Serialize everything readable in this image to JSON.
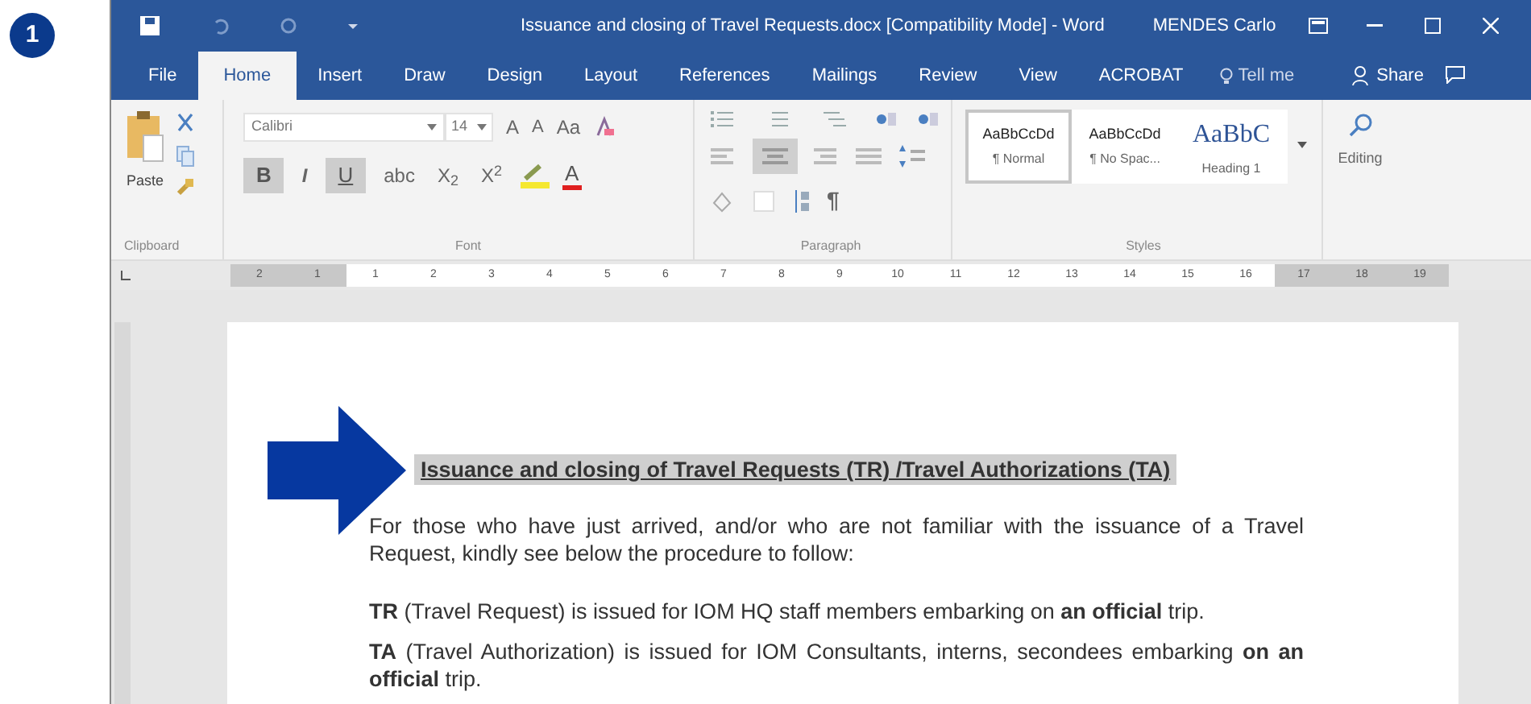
{
  "step_badge": "1",
  "window": {
    "title": "Issuance and closing of Travel Requests.docx [Compatibility Mode]  -  Word",
    "user": "MENDES Carlo"
  },
  "tabs": [
    {
      "label": "File",
      "selected": false
    },
    {
      "label": "Home",
      "selected": true
    },
    {
      "label": "Insert",
      "selected": false
    },
    {
      "label": "Draw",
      "selected": false
    },
    {
      "label": "Design",
      "selected": false
    },
    {
      "label": "Layout",
      "selected": false
    },
    {
      "label": "References",
      "selected": false
    },
    {
      "label": "Mailings",
      "selected": false
    },
    {
      "label": "Review",
      "selected": false
    },
    {
      "label": "View",
      "selected": false
    },
    {
      "label": "ACROBAT",
      "selected": false
    }
  ],
  "tell_me": "Tell me",
  "share": "Share",
  "clipboard": {
    "paste": "Paste",
    "label": "Clipboard"
  },
  "font": {
    "name": "Calibri",
    "size": "14",
    "grow": "A",
    "shrink": "A",
    "change_case": "Aa",
    "label": "Font",
    "toggles": [
      {
        "text": "B",
        "pressed": true
      },
      {
        "text": "I",
        "pressed": false
      },
      {
        "text": "U",
        "pressed": true
      },
      {
        "text": "abc",
        "pressed": false
      },
      {
        "text": "X$_{2}$",
        "pressed": false
      },
      {
        "text": "X$^{2}$",
        "pressed": false
      }
    ],
    "font_color": "A"
  },
  "paragraph": {
    "label": "Paragraph",
    "show_marks": "¶"
  },
  "styles": {
    "label": "Styles",
    "items": [
      {
        "preview": "AaBbCcDd",
        "name": "¶ Normal",
        "selected": true,
        "kind": "normal"
      },
      {
        "preview": "AaBbCcDd",
        "name": "¶ No Spac...",
        "selected": false,
        "kind": "normal"
      },
      {
        "preview": "AaBbC",
        "name": "Heading 1",
        "selected": false,
        "kind": "heading"
      }
    ]
  },
  "editing": "Editing",
  "ruler": [
    {
      "label": "2",
      "margin": true
    },
    {
      "label": "1",
      "margin": true
    },
    {
      "label": "1",
      "margin": false
    },
    {
      "label": "2",
      "margin": false
    },
    {
      "label": "3",
      "margin": false
    },
    {
      "label": "4",
      "margin": false
    },
    {
      "label": "5",
      "margin": false
    },
    {
      "label": "6",
      "margin": false
    },
    {
      "label": "7",
      "margin": false
    },
    {
      "label": "8",
      "margin": false
    },
    {
      "label": "9",
      "margin": false
    },
    {
      "label": "10",
      "margin": false
    },
    {
      "label": "11",
      "margin": false
    },
    {
      "label": "12",
      "margin": false
    },
    {
      "label": "13",
      "margin": false
    },
    {
      "label": "14",
      "margin": false
    },
    {
      "label": "15",
      "margin": false
    },
    {
      "label": "16",
      "margin": false
    },
    {
      "label": "17",
      "margin": true
    },
    {
      "label": "18",
      "margin": true
    },
    {
      "label": "19",
      "margin": true
    }
  ],
  "document": {
    "heading": "Issuance and closing of Travel Requests (TR) /Travel Authorizations (TA)",
    "paragraphs": [
      "For those who have just arrived, and/or who are not familiar with the issuance of a Travel Request, kindly see below the procedure to follow:",
      "**TR** (Travel Request) is issued for IOM HQ staff members embarking on **an official** trip.",
      "**TA** (Travel Authorization) is issued for IOM Consultants, interns, secondees embarking **on an official** trip."
    ]
  }
}
